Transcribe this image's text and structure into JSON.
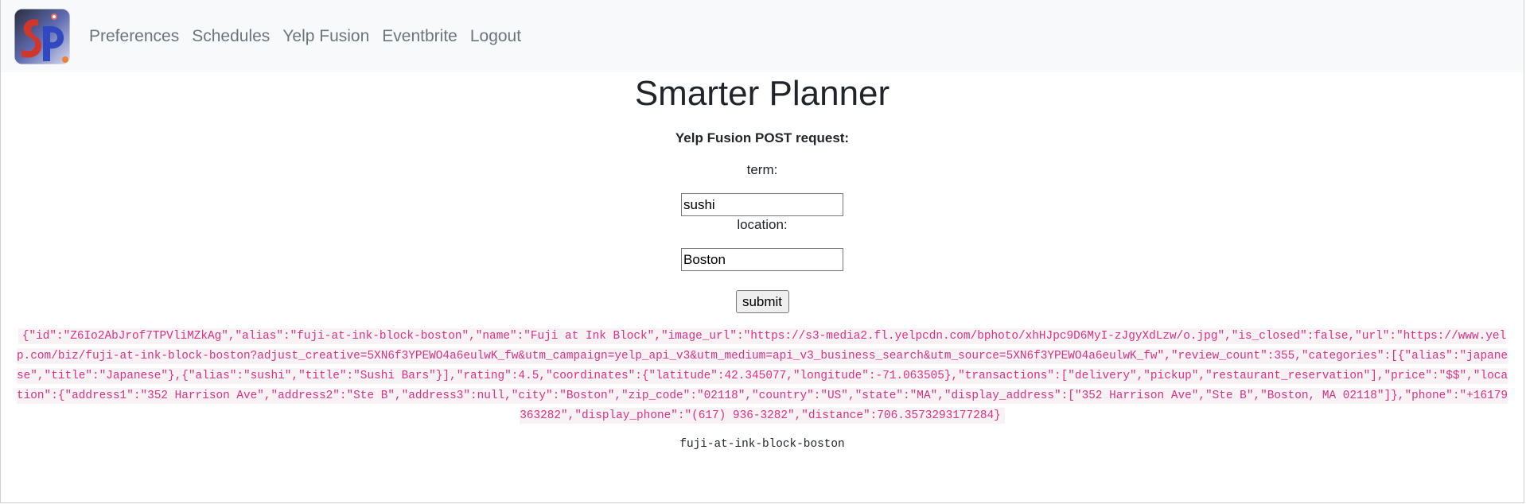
{
  "navbar": {
    "brand_logo_text": "SP",
    "links": [
      "Preferences",
      "Schedules",
      "Yelp Fusion",
      "Eventbrite",
      "Logout"
    ]
  },
  "main": {
    "title": "Smarter Planner",
    "form_title": "Yelp Fusion POST request:",
    "term_label": "term:",
    "term_value": "sushi",
    "location_label": "location:",
    "location_value": "Boston",
    "submit_label": "submit",
    "json_response": "{\"id\":\"Z6Io2AbJrof7TPVliMZkAg\",\"alias\":\"fuji-at-ink-block-boston\",\"name\":\"Fuji at Ink Block\",\"image_url\":\"https://s3-media2.fl.yelpcdn.com/bphoto/xhHJpc9D6MyI-zJgyXdLzw/o.jpg\",\"is_closed\":false,\"url\":\"https://www.yelp.com/biz/fuji-at-ink-block-boston?adjust_creative=5XN6f3YPEWO4a6eulwK_fw&utm_campaign=yelp_api_v3&utm_medium=api_v3_business_search&utm_source=5XN6f3YPEWO4a6eulwK_fw\",\"review_count\":355,\"categories\":[{\"alias\":\"japanese\",\"title\":\"Japanese\"},{\"alias\":\"sushi\",\"title\":\"Sushi Bars\"}],\"rating\":4.5,\"coordinates\":{\"latitude\":42.345077,\"longitude\":-71.063505},\"transactions\":[\"delivery\",\"pickup\",\"restaurant_reservation\"],\"price\":\"$$\",\"location\":{\"address1\":\"352 Harrison Ave\",\"address2\":\"Ste B\",\"address3\":null,\"city\":\"Boston\",\"zip_code\":\"02118\",\"country\":\"US\",\"state\":\"MA\",\"display_address\":[\"352 Harrison Ave\",\"Ste B\",\"Boston, MA 02118\"]},\"phone\":\"+16179363282\",\"display_phone\":\"(617) 936-3282\",\"distance\":706.3573293177284}",
    "alias_result": "fuji-at-ink-block-boston"
  },
  "colors": {
    "navbar_bg": "#f8f9fa",
    "nav_link": "#6c757d",
    "code_text": "#d63384"
  }
}
